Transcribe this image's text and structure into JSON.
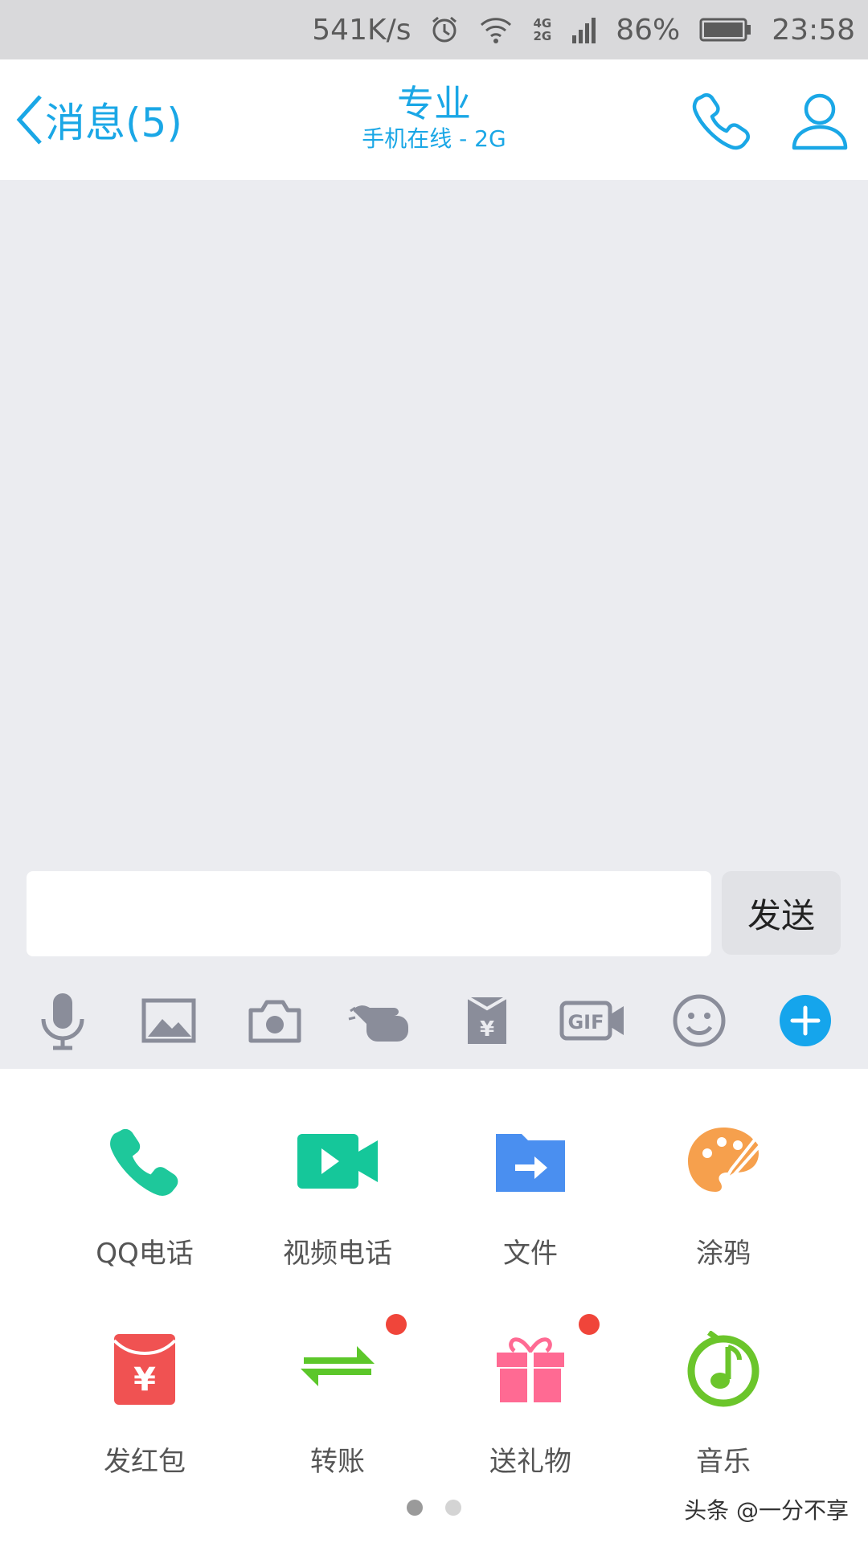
{
  "status_bar": {
    "speed": "541K/s",
    "network_top": "4G",
    "network_bottom": "2G",
    "battery": "86%",
    "time": "23:58"
  },
  "header": {
    "back_label": "消息(5)",
    "contact_name": "专业",
    "contact_status": "手机在线 - 2G"
  },
  "composer": {
    "input_value": "",
    "send_label": "发送"
  },
  "toolbar": {
    "icons": [
      "microphone-icon",
      "image-icon",
      "camera-icon",
      "poke-icon",
      "red-envelope-icon",
      "gif-icon",
      "emoji-icon",
      "plus-icon"
    ]
  },
  "panel": {
    "items": [
      {
        "label": "QQ电话",
        "icon": "phone-icon",
        "color": "#1ec89b",
        "badge": false
      },
      {
        "label": "视频电话",
        "icon": "video-call-icon",
        "color": "#15c79a",
        "badge": false
      },
      {
        "label": "文件",
        "icon": "file-icon",
        "color": "#4a8ff0",
        "badge": false
      },
      {
        "label": "涂鸦",
        "icon": "palette-icon",
        "color": "#f6a04d",
        "badge": false
      },
      {
        "label": "发红包",
        "icon": "red-packet-icon",
        "color": "#f05252",
        "badge": false
      },
      {
        "label": "转账",
        "icon": "transfer-icon",
        "color": "#5cc72a",
        "badge": true
      },
      {
        "label": "送礼物",
        "icon": "gift-icon",
        "color": "#ff6a93",
        "badge": true
      },
      {
        "label": "音乐",
        "icon": "music-icon",
        "color": "#6bc52b",
        "badge": false
      }
    ],
    "pages": 2,
    "active_page": 1
  },
  "watermark": "头条 @一分不享",
  "colors": {
    "accent": "#1aa7e6",
    "badge": "#f0453a"
  }
}
